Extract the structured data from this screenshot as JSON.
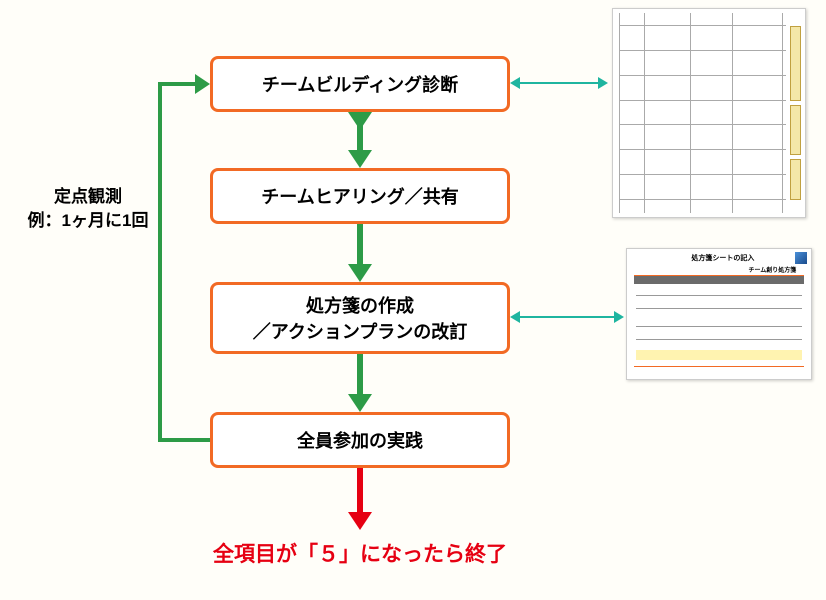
{
  "boxes": {
    "b1": "チームビルディング診断",
    "b2": "チームヒアリング／共有",
    "b3": "処方箋の作成\n／アクションプランの改訂",
    "b4": "全員参加の実践"
  },
  "side_label": "定点観測\n例：1ヶ月に1回",
  "end_text": "全項目が「５」になったら終了",
  "thumb2": {
    "title": "処方箋シートの記入",
    "subtitle": "チーム創り処方箋"
  }
}
